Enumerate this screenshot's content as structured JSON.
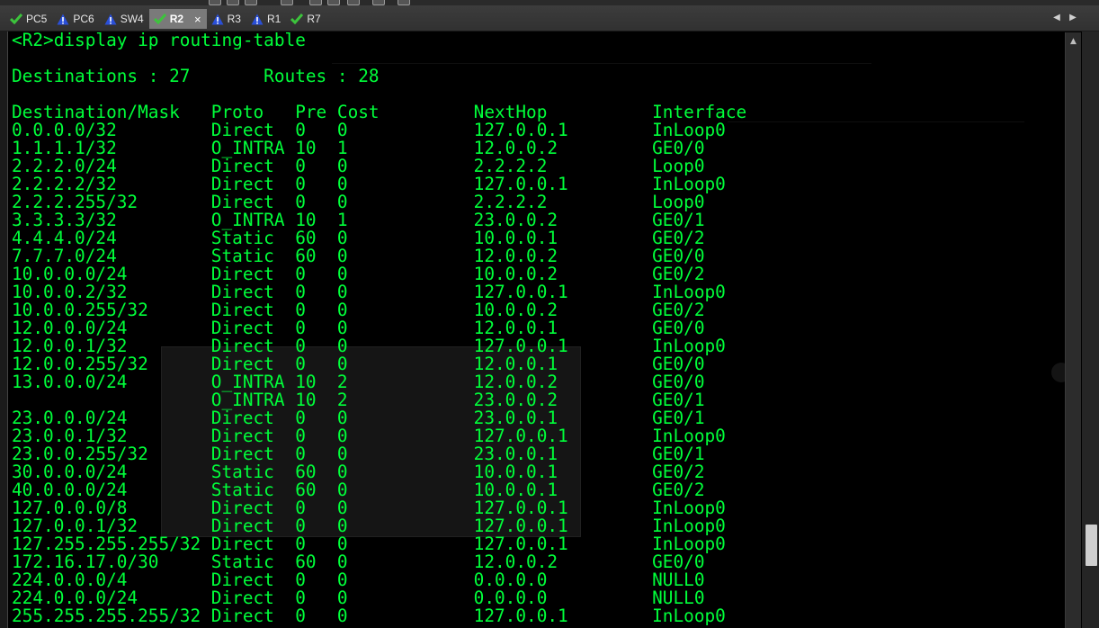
{
  "tabs": [
    {
      "label": "PC5",
      "icon": "check-icon",
      "active": false
    },
    {
      "label": "PC6",
      "icon": "warning-icon",
      "active": false
    },
    {
      "label": "SW4",
      "icon": "warning-icon",
      "active": false
    },
    {
      "label": "R2",
      "icon": "check-icon",
      "active": true
    },
    {
      "label": "R3",
      "icon": "warning-icon",
      "active": false
    },
    {
      "label": "R1",
      "icon": "warning-icon",
      "active": false
    },
    {
      "label": "R7",
      "icon": "check-icon",
      "active": false
    }
  ],
  "tab_close_glyph": "×",
  "tab_nav": {
    "prev": "◀",
    "next": "▶"
  },
  "colors": {
    "console_text": "#00ff3a",
    "console_bg": "#000000",
    "tab_active_bg": "#7a7a7a",
    "check": "#3cc43c",
    "warning": "#2a4fd8"
  },
  "console": {
    "command": "<R2>display ip routing-table",
    "summary": "Destinations : 27       Routes : 28",
    "header": "Destination/Mask   Proto   Pre Cost         NextHop          Interface",
    "rows": [
      "0.0.0.0/32         Direct  0   0            127.0.0.1        InLoop0",
      "1.1.1.1/32         O_INTRA 10  1            12.0.0.2         GE0/0",
      "2.2.2.0/24         Direct  0   0            2.2.2.2          Loop0",
      "2.2.2.2/32         Direct  0   0            127.0.0.1        InLoop0",
      "2.2.2.255/32       Direct  0   0            2.2.2.2          Loop0",
      "3.3.3.3/32         O_INTRA 10  1            23.0.0.2         GE0/1",
      "4.4.4.0/24         Static  60  0            10.0.0.1         GE0/2",
      "7.7.7.0/24         Static  60  0            12.0.0.2         GE0/0",
      "10.0.0.0/24        Direct  0   0            10.0.0.2         GE0/2",
      "10.0.0.2/32        Direct  0   0            127.0.0.1        InLoop0",
      "10.0.0.255/32      Direct  0   0            10.0.0.2         GE0/2",
      "12.0.0.0/24        Direct  0   0            12.0.0.1         GE0/0",
      "12.0.0.1/32        Direct  0   0            127.0.0.1        InLoop0",
      "12.0.0.255/32      Direct  0   0            12.0.0.1         GE0/0",
      "13.0.0.0/24        O_INTRA 10  2            12.0.0.2         GE0/0",
      "                   O_INTRA 10  2            23.0.0.2         GE0/1",
      "23.0.0.0/24        Direct  0   0            23.0.0.1         GE0/1",
      "23.0.0.1/32        Direct  0   0            127.0.0.1        InLoop0",
      "23.0.0.255/32      Direct  0   0            23.0.0.1         GE0/1",
      "30.0.0.0/24        Static  60  0            10.0.0.1         GE0/2",
      "40.0.0.0/24        Static  60  0            10.0.0.1         GE0/2",
      "127.0.0.0/8        Direct  0   0            127.0.0.1        InLoop0",
      "127.0.0.1/32       Direct  0   0            127.0.0.1        InLoop0",
      "127.255.255.255/32 Direct  0   0            127.0.0.1        InLoop0",
      "172.16.17.0/30     Static  60  0            12.0.0.2         GE0/0",
      "224.0.0.0/4        Direct  0   0            0.0.0.0          NULL0",
      "224.0.0.0/24       Direct  0   0            0.0.0.0          NULL0",
      "255.255.255.255/32 Direct  0   0            127.0.0.1        InLoop0"
    ]
  },
  "scrollbar": {
    "up_arrow": "▲"
  }
}
